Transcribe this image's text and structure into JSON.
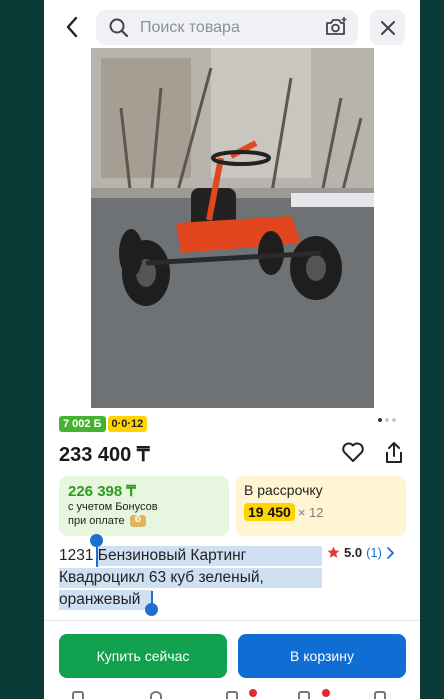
{
  "search": {
    "placeholder": "Поиск товара"
  },
  "badges": {
    "bonus": "7 002 Б",
    "installment_plan": "0·0·12"
  },
  "product": {
    "price": "233 400 ₸",
    "title": "1231 Бензиновый Картинг Квадроцикл 63 куб зеленый, оранжевый",
    "rating": "5.0",
    "reviews_count": "(1)",
    "gallery": {
      "current": 1,
      "total": 3
    }
  },
  "bonus_card": {
    "amount": "226 398 ₸",
    "line1": "с учетом Бонусов",
    "line2": "при оплате"
  },
  "installment_card": {
    "label": "В рассрочку",
    "monthly": "19 450",
    "multiplier": "× 12"
  },
  "actions": {
    "buy_now": "Купить сейчас",
    "add_to_cart": "В корзину"
  },
  "colors": {
    "buy_button": "#12a14f",
    "cart_button": "#0f6dd4",
    "bonus_green": "#2c9b1e",
    "installment_yellow": "#ffd400"
  }
}
